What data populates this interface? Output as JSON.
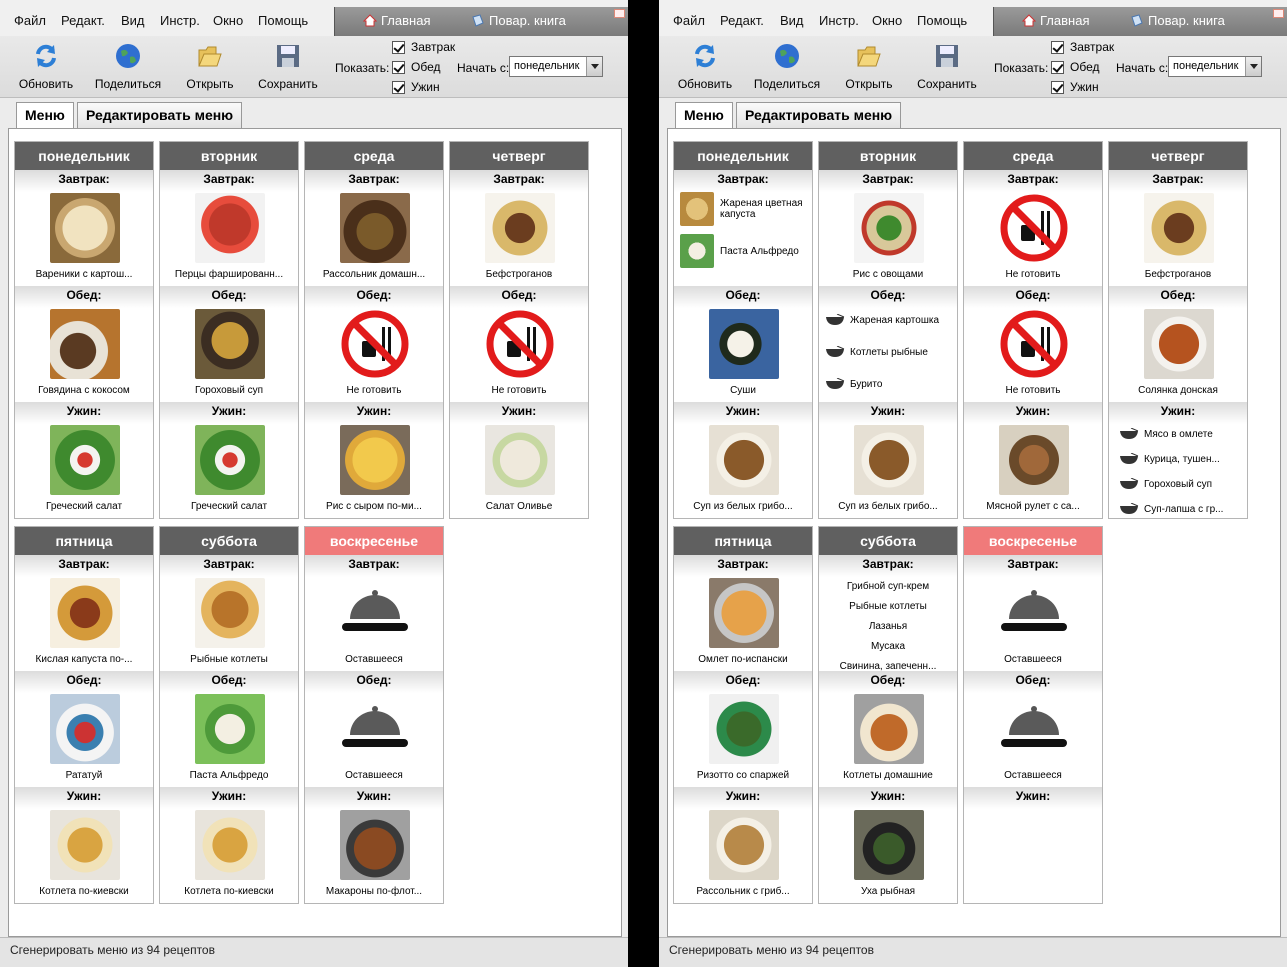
{
  "menu": {
    "file": "Файл",
    "edit": "Редакт.",
    "view": "Вид",
    "tools": "Инстр.",
    "window": "Окно",
    "help": "Помощь"
  },
  "nav": {
    "home": "Главная",
    "cookbook": "Повар. книга"
  },
  "toolbar": {
    "refresh": "Обновить",
    "share": "Поделиться",
    "open": "Открыть",
    "save": "Сохранить",
    "show_label": "Показать:",
    "breakfast": "Завтрак",
    "lunch": "Обед",
    "dinner": "Ужин",
    "start_label": "Начать с:",
    "start_value": "понедельник"
  },
  "tabs": {
    "menu": "Меню",
    "edit_menu": "Редактировать меню"
  },
  "status": "Сгенерировать меню из 94 рецептов",
  "labels": {
    "breakfast": "Завтрак:",
    "lunch": "Обед:",
    "dinner": "Ужин:"
  },
  "colors": {
    "header": "#606060",
    "sunday": "#f07a7a",
    "prohibit": "#e21b1b"
  },
  "window_a": {
    "days": [
      {
        "name": "понедельник",
        "breakfast": "Вареники с картош...",
        "lunch": "Говядина с кокосом",
        "dinner": "Греческий салат"
      },
      {
        "name": "вторник",
        "breakfast": "Перцы фаршированн...",
        "lunch": "Гороховый суп",
        "dinner": "Греческий салат"
      },
      {
        "name": "среда",
        "breakfast": "Рассольник домашн...",
        "lunch": "Не готовить",
        "dinner": "Рис с сыром по-ми..."
      },
      {
        "name": "четверг",
        "breakfast": "Бефстроганов",
        "lunch": "Не готовить",
        "dinner": "Салат Оливье"
      },
      {
        "name": "пятница",
        "breakfast": "Кислая капуста по-...",
        "lunch": "Рататуй",
        "dinner": "Котлета по-киевски"
      },
      {
        "name": "суббота",
        "breakfast": "Рыбные котлеты",
        "lunch": "Паста Альфредо",
        "dinner": "Котлета по-киевски"
      },
      {
        "name": "воскресенье",
        "breakfast": "Оставшееся",
        "lunch": "Оставшееся",
        "dinner": "Макароны по-флот..."
      }
    ]
  },
  "window_b": {
    "days": [
      {
        "name": "понедельник",
        "breakfast_items": [
          "Жареная цветная капуста",
          "Паста Альфредо"
        ],
        "lunch": "Суши",
        "dinner": "Суп из белых грибо..."
      },
      {
        "name": "вторник",
        "breakfast": "Рис с овощами",
        "lunch_items": [
          "Жареная картошка",
          "Котлеты рыбные",
          "Бурито"
        ],
        "dinner": "Суп из белых грибо..."
      },
      {
        "name": "среда",
        "breakfast": "Не готовить",
        "lunch": "Не готовить",
        "dinner": "Мясной рулет с са..."
      },
      {
        "name": "четверг",
        "breakfast": "Бефстроганов",
        "lunch": "Солянка донская",
        "dinner_items": [
          "Мясо в омлете",
          "Курица, тушен...",
          "Гороховый суп",
          "Суп-лапша с гр..."
        ]
      },
      {
        "name": "пятница",
        "breakfast": "Омлет по-испански",
        "lunch": "Ризотто со спаржей",
        "dinner": "Рассольник с гриб..."
      },
      {
        "name": "суббота",
        "breakfast_items": [
          "Грибной суп-крем",
          "Рыбные котлеты",
          "Лазанья",
          "Мусака",
          "Свинина, запеченн..."
        ],
        "lunch": "Котлеты домашние",
        "dinner": "Уха рыбная"
      },
      {
        "name": "воскресенье",
        "breakfast": "Оставшееся",
        "lunch": "Оставшееся",
        "dinner": ""
      }
    ]
  }
}
